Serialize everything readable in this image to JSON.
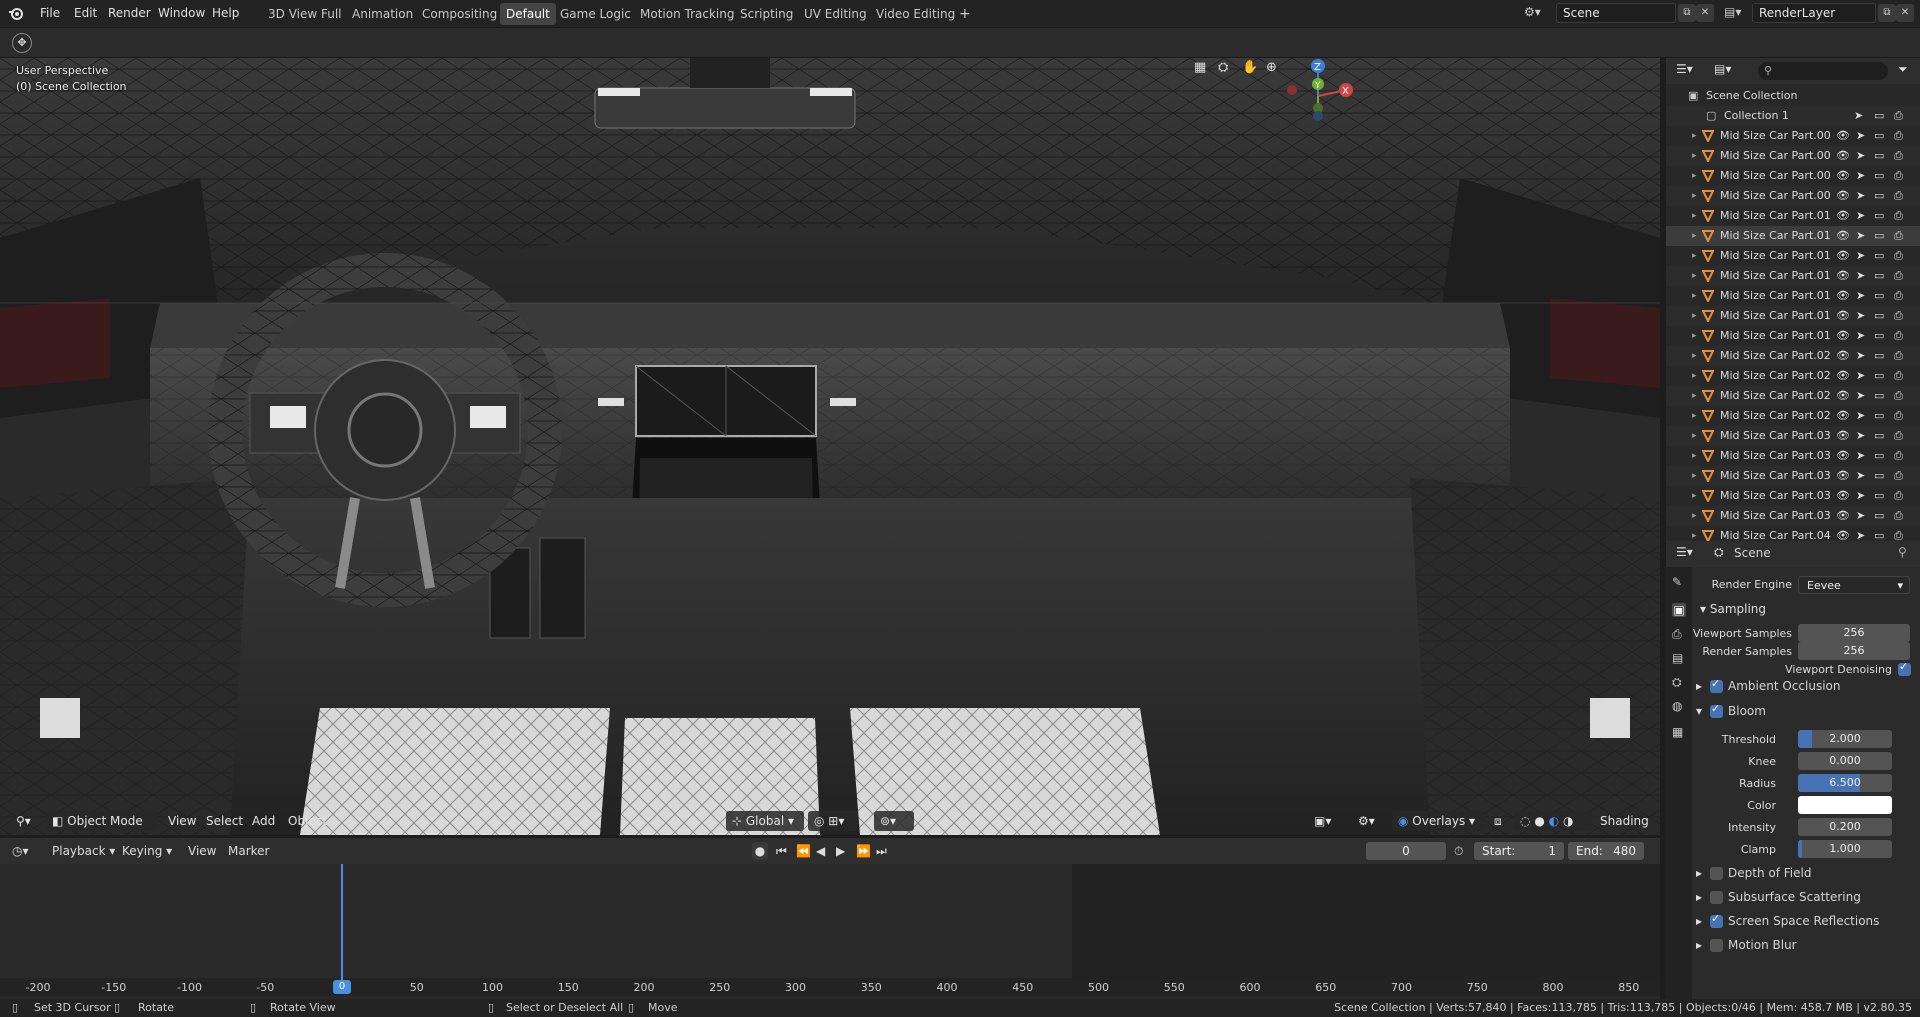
{
  "topbar": {
    "menus": [
      "File",
      "Edit",
      "Render",
      "Window",
      "Help"
    ],
    "workspaces": [
      "3D View Full",
      "Animation",
      "Compositing",
      "Default",
      "Game Logic",
      "Motion Tracking",
      "Scripting",
      "UV Editing",
      "Video Editing"
    ],
    "active_workspace": "Default",
    "add_tab": "+",
    "scene_name": "Scene",
    "view_layer_name": "RenderLayer"
  },
  "viewport": {
    "view_name": "User Perspective",
    "collection_label": "(0) Scene Collection",
    "mode": "Object Mode",
    "menus": [
      "View",
      "Select",
      "Add",
      "Object"
    ],
    "orientation": "Global",
    "overlays_label": "Overlays",
    "shading_label": "Shading",
    "gizmo_axes": {
      "x": "X",
      "y": "Y",
      "z": "Z"
    }
  },
  "timeline": {
    "menus": [
      "Playback",
      "Keying",
      "View",
      "Marker"
    ],
    "current_frame": "0",
    "start_label": "Start:",
    "start_value": "1",
    "end_label": "End:",
    "end_value": "480",
    "ruler": [
      "-200",
      "-150",
      "-100",
      "-50",
      "0",
      "50",
      "100",
      "150",
      "200",
      "250",
      "300",
      "350",
      "400",
      "450",
      "500",
      "550",
      "600",
      "650",
      "700",
      "750",
      "800",
      "850"
    ],
    "playhead_frame": 0
  },
  "statusbar": {
    "left_items": [
      "Set 3D Cursor",
      "Rotate",
      "Rotate View",
      "Select or Deselect All",
      "Move"
    ],
    "stats": "Scene Collection | Verts:57,840 | Faces:113,785 | Tris:113,785 | Objects:0/46 | Mem: 458.7 MB | v2.80.35"
  },
  "outliner": {
    "root": "Scene Collection",
    "collection": "Collection 1",
    "objects": [
      "Mid Size Car Part.00",
      "Mid Size Car Part.00",
      "Mid Size Car Part.00",
      "Mid Size Car Part.00",
      "Mid Size Car Part.01",
      "Mid Size Car Part.01",
      "Mid Size Car Part.01",
      "Mid Size Car Part.01",
      "Mid Size Car Part.01",
      "Mid Size Car Part.01",
      "Mid Size Car Part.01",
      "Mid Size Car Part.02",
      "Mid Size Car Part.02",
      "Mid Size Car Part.02",
      "Mid Size Car Part.02",
      "Mid Size Car Part.03",
      "Mid Size Car Part.03",
      "Mid Size Car Part.03",
      "Mid Size Car Part.03",
      "Mid Size Car Part.03",
      "Mid Size Car Part.04"
    ],
    "selected_index": 5
  },
  "properties": {
    "context": "Scene",
    "render_engine_label": "Render Engine",
    "render_engine": "Eevee",
    "sampling_label": "Sampling",
    "viewport_samples_label": "Viewport Samples",
    "viewport_samples": "256",
    "render_samples_label": "Render Samples",
    "render_samples": "256",
    "viewport_denoising_label": "Viewport Denoising",
    "viewport_denoising": true,
    "ambient_occlusion_label": "Ambient Occlusion",
    "ambient_occlusion": true,
    "bloom_label": "Bloom",
    "bloom": true,
    "bloom_threshold_label": "Threshold",
    "bloom_threshold": "2.000",
    "bloom_knee_label": "Knee",
    "bloom_knee": "0.000",
    "bloom_radius_label": "Radius",
    "bloom_radius": "6.500",
    "bloom_color_label": "Color",
    "bloom_color": "#ffffff",
    "bloom_intensity_label": "Intensity",
    "bloom_intensity": "0.200",
    "bloom_clamp_label": "Clamp",
    "bloom_clamp": "1.000",
    "dof_label": "Depth of Field",
    "dof": false,
    "sss_label": "Subsurface Scattering",
    "sss": false,
    "ssr_label": "Screen Space Reflections",
    "ssr": true,
    "motion_blur_label": "Motion Blur",
    "motion_blur": false
  },
  "colors": {
    "accent": "#4772b3",
    "object_icon": "#e8913a",
    "playhead": "#4a8fe0"
  }
}
